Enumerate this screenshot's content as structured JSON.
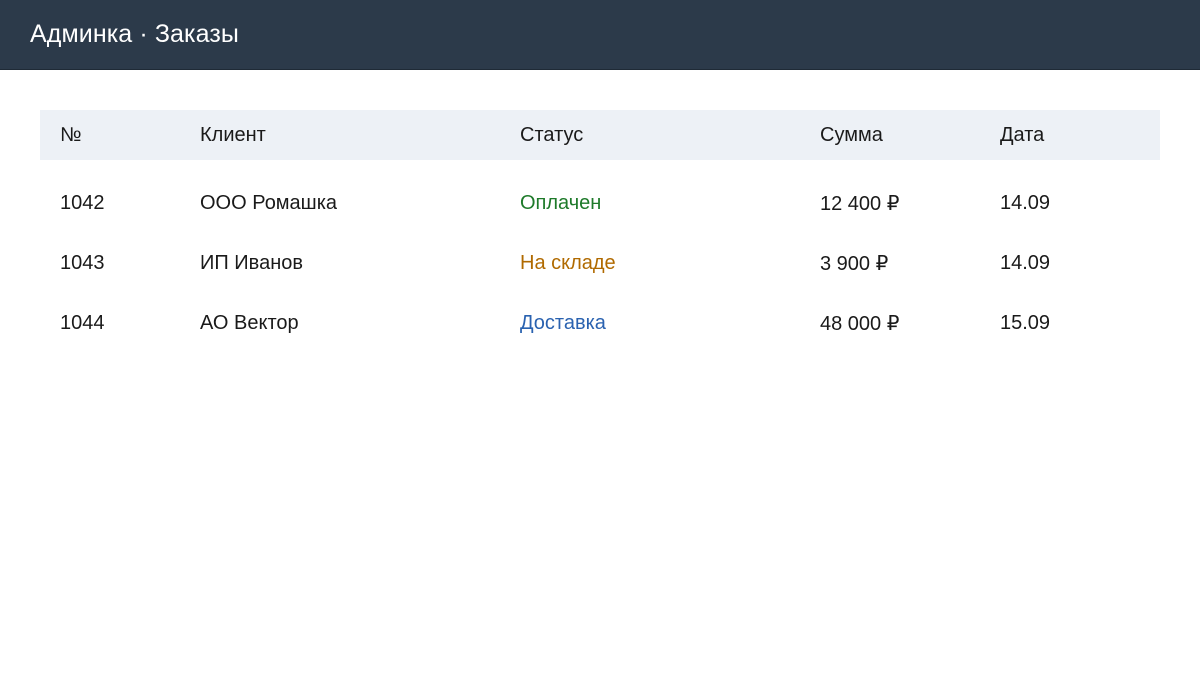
{
  "header": {
    "title": "Админка · Заказы"
  },
  "table": {
    "columns": [
      "№",
      "Клиент",
      "Статус",
      "Сумма",
      "Дата"
    ],
    "rows": [
      {
        "id": "1042",
        "client": "ООО Ромашка",
        "status": "Оплачен",
        "status_color": "#1e7a2a",
        "sum": "12 400 ₽",
        "date": "14.09"
      },
      {
        "id": "1043",
        "client": "ИП Иванов",
        "status": "На складе",
        "status_color": "#b06a00",
        "sum": "3 900 ₽",
        "date": "14.09"
      },
      {
        "id": "1044",
        "client": "АО Вектор",
        "status": "Доставка",
        "status_color": "#2a62b0",
        "sum": "48 000 ₽",
        "date": "15.09"
      }
    ]
  },
  "colors": {
    "header_bg": "#2c3a4a",
    "table_header_bg": "#edf1f6"
  }
}
